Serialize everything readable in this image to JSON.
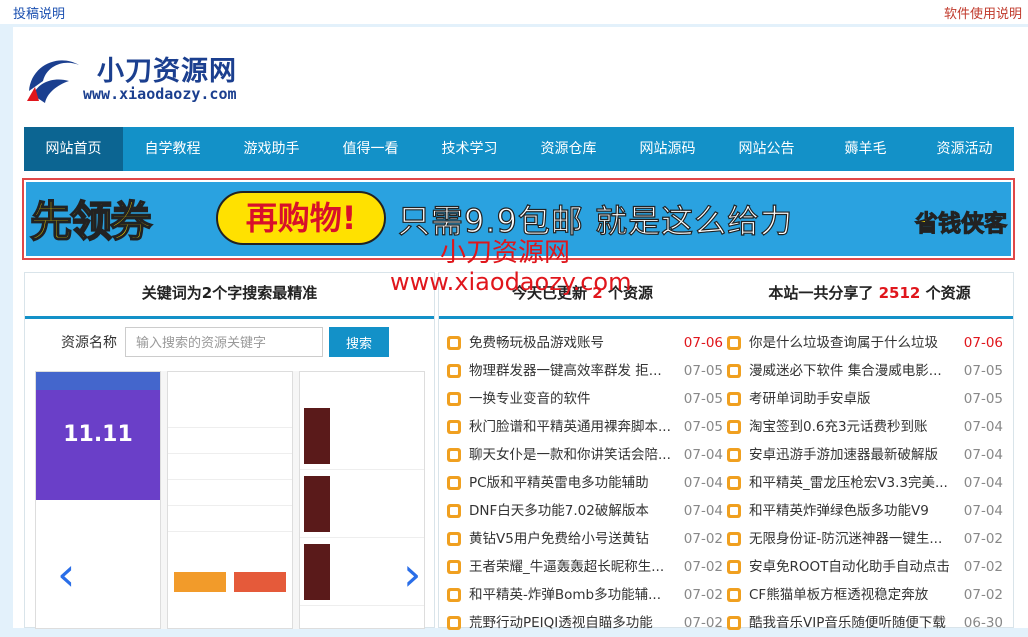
{
  "topbar": {
    "left": "投稿说明",
    "right": "软件使用说明"
  },
  "logo": {
    "name": "小刀资源网",
    "url": "www.xiaodaozy.com"
  },
  "nav": [
    "网站首页",
    "自学教程",
    "游戏助手",
    "值得一看",
    "技术学习",
    "资源仓库",
    "网站源码",
    "网站公告",
    "薅羊毛",
    "资源活动"
  ],
  "banner": {
    "part1": "先领券",
    "part2": "再购物!",
    "part3": "只需9.9包邮 就是这么给力",
    "part4": "省钱侠客"
  },
  "watermark": {
    "line1": "小刀资源网",
    "line2": "www.xiaodaozy.com"
  },
  "left_panel": {
    "title": "关键词为2个字搜索最精准",
    "search_label": "资源名称",
    "search_placeholder": "输入搜索的资源关键字",
    "search_button": "搜索",
    "shots": {
      "promo": "11.11"
    }
  },
  "right_panel": {
    "today_prefix": "今天已更新",
    "today_count": "2",
    "today_suffix": "个资源",
    "total_prefix": "本站一共分享了",
    "total_count": "2512",
    "total_suffix": "个资源",
    "col1": [
      {
        "title": "免费畅玩极品游戏账号",
        "date": "07-06",
        "hot": true
      },
      {
        "title": "物理群发器一键高效率群发 拒...",
        "date": "07-05",
        "hot": false
      },
      {
        "title": "一换专业变音的软件",
        "date": "07-05",
        "hot": false
      },
      {
        "title": "秋门脸谱和平精英通用裸奔脚本...",
        "date": "07-05",
        "hot": false
      },
      {
        "title": "聊天女仆是一款和你讲笑话会陪...",
        "date": "07-04",
        "hot": false
      },
      {
        "title": "PC版和平精英雷电多功能辅助",
        "date": "07-04",
        "hot": false
      },
      {
        "title": "DNF白天多功能7.02破解版本",
        "date": "07-04",
        "hot": false
      },
      {
        "title": "黄钻V5用户免费给小号送黄钻",
        "date": "07-02",
        "hot": false
      },
      {
        "title": "王者荣耀_牛逼轰轰超长昵称生...",
        "date": "07-02",
        "hot": false
      },
      {
        "title": "和平精英-炸弹Bomb多功能辅...",
        "date": "07-02",
        "hot": false
      },
      {
        "title": "荒野行动PEIQI透视自瞄多功能",
        "date": "07-02",
        "hot": false
      }
    ],
    "col2": [
      {
        "title": "你是什么垃圾查询属于什么垃圾",
        "date": "07-06",
        "hot": true
      },
      {
        "title": "漫威迷必下软件 集合漫威电影...",
        "date": "07-05",
        "hot": false
      },
      {
        "title": "考研单词助手安卓版",
        "date": "07-05",
        "hot": false
      },
      {
        "title": "淘宝签到0.6充3元话费秒到账",
        "date": "07-04",
        "hot": false
      },
      {
        "title": "安卓迅游手游加速器最新破解版",
        "date": "07-04",
        "hot": false
      },
      {
        "title": "和平精英_雷龙压枪宏V3.3完美...",
        "date": "07-04",
        "hot": false
      },
      {
        "title": "和平精英炸弹绿色版多功能V9",
        "date": "07-04",
        "hot": false
      },
      {
        "title": "无限身份证-防沉迷神器一键生...",
        "date": "07-02",
        "hot": false
      },
      {
        "title": "安卓免ROOT自动化助手自动点击",
        "date": "07-02",
        "hot": false
      },
      {
        "title": "CF熊猫单板方框透视稳定奔放",
        "date": "07-02",
        "hot": false
      },
      {
        "title": "酷我音乐VIP音乐随便听随便下载",
        "date": "06-30",
        "hot": false
      }
    ]
  }
}
